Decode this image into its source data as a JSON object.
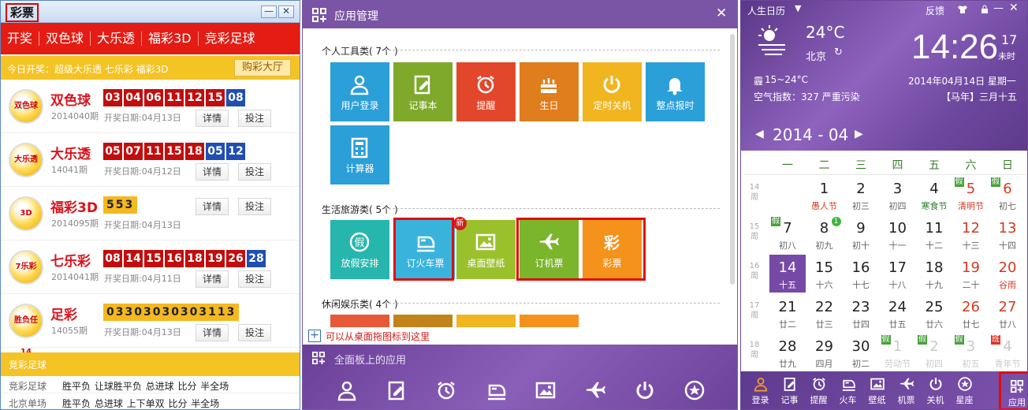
{
  "lottery": {
    "title": "彩票",
    "win_min": "—",
    "win_close": "✕",
    "nav": [
      "开奖",
      "双色球",
      "大乐透",
      "福彩3D",
      "竞彩足球"
    ],
    "today": "今日开奖：超级大乐透 七乐彩 福彩3D",
    "buy_hall": "购彩大厅",
    "detail_label": "详情",
    "bet_label": "投注",
    "games": [
      {
        "name": "双色球",
        "issue": "2014040期",
        "date": "开奖日期:04月13日",
        "logo": "双色球",
        "balls": [
          "03",
          "04",
          "06",
          "11",
          "12",
          "15"
        ],
        "blue": [
          "08"
        ]
      },
      {
        "name": "大乐透",
        "issue": "14041期",
        "date": "开奖日期:04月12日",
        "logo": "大乐透",
        "balls": [
          "05",
          "07",
          "11",
          "15",
          "18"
        ],
        "blue": [
          "05",
          "12"
        ]
      },
      {
        "name": "福彩3D",
        "issue": "2014095期",
        "date": "开奖日期:04月13日",
        "logo": "3D",
        "yellow": "553",
        "balls": [],
        "blue": []
      },
      {
        "name": "七乐彩",
        "issue": "2014041期",
        "date": "开奖日期:04月11日",
        "logo": "7乐彩",
        "balls": [
          "08",
          "14",
          "15",
          "16",
          "18",
          "19",
          "26"
        ],
        "blue": [
          "28"
        ]
      },
      {
        "name": "足彩",
        "issue": "14055期",
        "date": "开奖日期:04月13日",
        "logo": "胜负任14",
        "yellow": "03303030303113",
        "balls": [],
        "blue": []
      }
    ],
    "football_header": "竞彩足球",
    "football_rows": [
      {
        "k": "竞彩足球",
        "v": "胜平负 让球胜平负 总进球 比分 半全场"
      },
      {
        "k": "北京单场",
        "v": "胜平负 总进球 上下单双 比分 半全场"
      }
    ]
  },
  "apps": {
    "title": "应用管理",
    "close": "✕",
    "section_personal": "个人工具类( 7个 )",
    "section_life": "生活旅游类( 5个 )",
    "section_fun": "休闲娱乐类( 4个 )",
    "personal": [
      {
        "label": "用户登录",
        "color": "#2a9fd8",
        "icon": "user-icon"
      },
      {
        "label": "记事本",
        "color": "#7fa92a",
        "icon": "notepad-icon"
      },
      {
        "label": "提醒",
        "color": "#e3472b",
        "icon": "alarm-clock-icon"
      },
      {
        "label": "生日",
        "color": "#e07d1c",
        "icon": "cake-icon"
      },
      {
        "label": "定时关机",
        "color": "#f0b51f",
        "icon": "power-icon"
      },
      {
        "label": "整点报时",
        "color": "#2a9fd8",
        "icon": "bell-icon"
      },
      {
        "label": "计算器",
        "color": "#2a9fd8",
        "icon": "calculator-icon"
      }
    ],
    "life": [
      {
        "label": "放假安排",
        "color": "#26b6ad",
        "icon": "holiday-icon"
      },
      {
        "label": "订火车票",
        "color": "#3ab3dc",
        "icon": "train-icon"
      },
      {
        "label": "桌面壁纸",
        "color": "#9ac12c",
        "icon": "picture-icon",
        "badge": "新"
      },
      {
        "label": "订机票",
        "color": "#7ab52b",
        "icon": "plane-icon"
      },
      {
        "label": "彩票",
        "color": "#f4921c",
        "icon": "lottery-icon"
      }
    ],
    "fun_colors": [
      "#e8593a",
      "#c2831b",
      "#f0b51f",
      "#f4921c"
    ],
    "drag_hint": "可以从桌面拖图标到这里",
    "dock_title": "全面板上的应用",
    "dock_icons": [
      "user-icon",
      "notepad-icon",
      "alarm-clock-icon",
      "train-icon",
      "picture-icon",
      "plane-icon",
      "power-icon",
      "star-icon"
    ]
  },
  "calendar": {
    "app_title": "人生日历",
    "feedback": "反馈",
    "temp": "24°C",
    "city": "北京",
    "range": "15~24°C",
    "weather_tag": "霾",
    "aqi": "空气指数：327 严重污染",
    "time": "14:26",
    "seconds": "17",
    "seconds_label": "未时",
    "date": "2014年04月14日  星期一",
    "lunar": "【马年】三月十五",
    "month": "2014 - 04",
    "weekdays": [
      "一",
      "二",
      "三",
      "四",
      "五",
      "六",
      "日"
    ],
    "week_label": "周",
    "weeks": [
      {
        "wk": "14",
        "days": [
          {
            "d": "",
            "l": ""
          },
          {
            "d": "1",
            "l": "愚人节",
            "fes": true
          },
          {
            "d": "2",
            "l": "初三"
          },
          {
            "d": "3",
            "l": "初四"
          },
          {
            "d": "4",
            "l": "寒食节",
            "fes": true,
            "g": true
          },
          {
            "d": "5",
            "l": "清明节",
            "we": true,
            "fes": true,
            "mark": "假"
          },
          {
            "d": "6",
            "l": "初七",
            "we": true,
            "mark": "假"
          }
        ]
      },
      {
        "wk": "15",
        "days": [
          {
            "d": "7",
            "l": "初八",
            "mark": "假"
          },
          {
            "d": "8",
            "l": "初九",
            "dot": "1"
          },
          {
            "d": "9",
            "l": "初十"
          },
          {
            "d": "10",
            "l": "十一"
          },
          {
            "d": "11",
            "l": "十二"
          },
          {
            "d": "12",
            "l": "十三",
            "we": true
          },
          {
            "d": "13",
            "l": "十四",
            "we": true
          }
        ]
      },
      {
        "wk": "16",
        "days": [
          {
            "d": "14",
            "l": "十五",
            "today": true
          },
          {
            "d": "15",
            "l": "十六"
          },
          {
            "d": "16",
            "l": "十七"
          },
          {
            "d": "17",
            "l": "十八"
          },
          {
            "d": "18",
            "l": "十九"
          },
          {
            "d": "19",
            "l": "二十",
            "we": true
          },
          {
            "d": "20",
            "l": "谷雨",
            "we": true,
            "fes": true
          }
        ]
      },
      {
        "wk": "17",
        "days": [
          {
            "d": "21",
            "l": "廿二"
          },
          {
            "d": "22",
            "l": "廿三"
          },
          {
            "d": "23",
            "l": "廿四"
          },
          {
            "d": "24",
            "l": "廿五"
          },
          {
            "d": "25",
            "l": "廿六"
          },
          {
            "d": "26",
            "l": "廿七",
            "we": true
          },
          {
            "d": "27",
            "l": "廿八",
            "we": true
          }
        ]
      },
      {
        "wk": "18",
        "days": [
          {
            "d": "28",
            "l": "廿九"
          },
          {
            "d": "29",
            "l": "四月"
          },
          {
            "d": "30",
            "l": "初二"
          },
          {
            "d": "1",
            "l": "劳动节",
            "dim": true,
            "mark": "假"
          },
          {
            "d": "2",
            "l": "初四",
            "dim": true,
            "mark": "假"
          },
          {
            "d": "3",
            "l": "初五",
            "dim": true,
            "mark": "假"
          },
          {
            "d": "4",
            "l": "青年节",
            "dim": true,
            "mark": "班",
            "ban": true
          }
        ]
      }
    ],
    "bottom": [
      {
        "label": "登录",
        "icon": "user-icon"
      },
      {
        "label": "记事",
        "icon": "notepad-icon"
      },
      {
        "label": "提醒",
        "icon": "alarm-clock-icon"
      },
      {
        "label": "火车",
        "icon": "train-icon"
      },
      {
        "label": "壁纸",
        "icon": "picture-icon"
      },
      {
        "label": "机票",
        "icon": "plane-icon"
      },
      {
        "label": "关机",
        "icon": "power-icon"
      },
      {
        "label": "星座",
        "icon": "star-icon"
      },
      {
        "label": "应用",
        "icon": "apps-grid-icon"
      }
    ]
  }
}
